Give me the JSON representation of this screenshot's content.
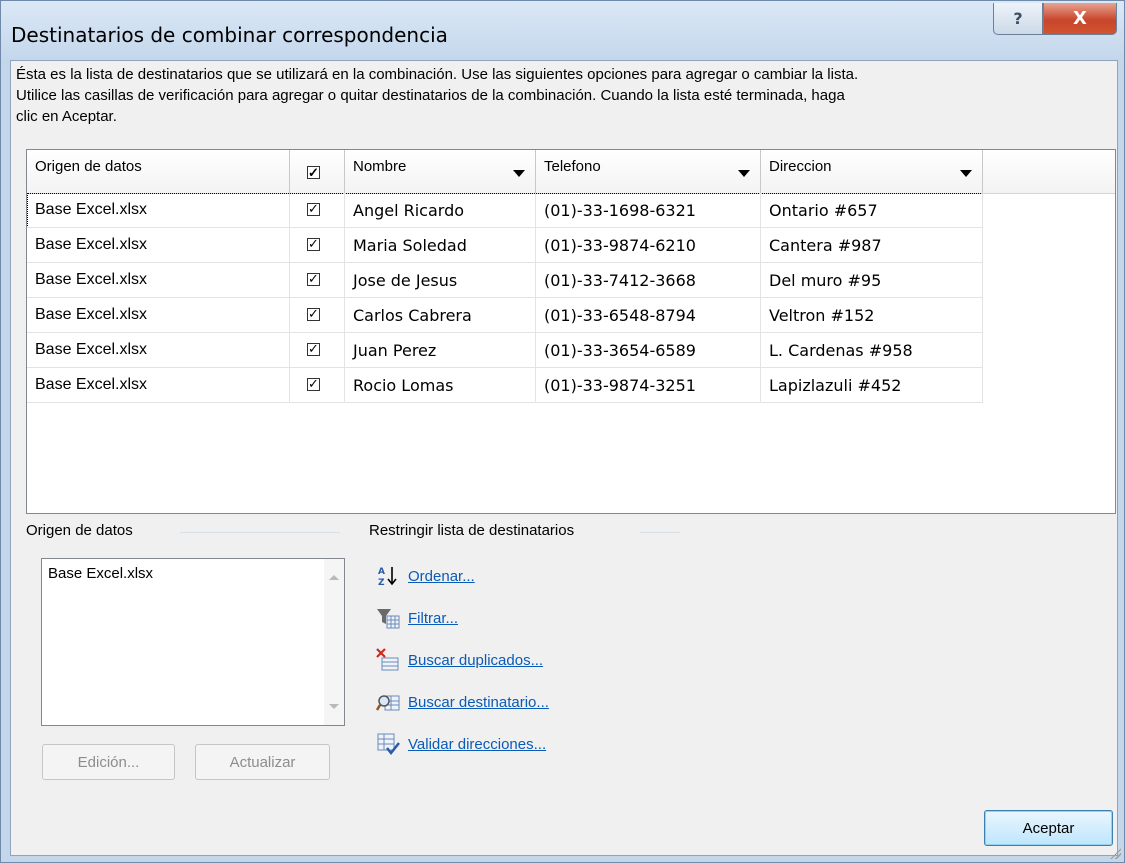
{
  "window": {
    "title": "Destinatarios de combinar correspondencia",
    "help_label": "?",
    "close_label": "X"
  },
  "intro": {
    "line1": "Ésta es la lista de destinatarios que se utilizará en la combinación. Use las siguientes opciones para agregar o cambiar la lista.",
    "line2": "Utilice las casillas de verificación para agregar o quitar destinatarios de la combinación. Cuando la lista esté terminada, haga",
    "line3": "clic en Aceptar."
  },
  "grid": {
    "columns": {
      "source": "Origen de datos",
      "nombre": "Nombre",
      "telefono": "Telefono",
      "direccion": "Direccion"
    },
    "rows": [
      {
        "source": "Base Excel.xlsx",
        "checked": true,
        "nombre": "Angel Ricardo",
        "telefono": "(01)-33-1698-6321",
        "direccion": "Ontario #657"
      },
      {
        "source": "Base Excel.xlsx",
        "checked": true,
        "nombre": "Maria Soledad",
        "telefono": "(01)-33-9874-6210",
        "direccion": "Cantera #987"
      },
      {
        "source": "Base Excel.xlsx",
        "checked": true,
        "nombre": "Jose de Jesus",
        "telefono": "(01)-33-7412-3668",
        "direccion": "Del muro #95"
      },
      {
        "source": "Base Excel.xlsx",
        "checked": true,
        "nombre": "Carlos Cabrera",
        "telefono": "(01)-33-6548-8794",
        "direccion": "Veltron #152"
      },
      {
        "source": "Base Excel.xlsx",
        "checked": true,
        "nombre": "Juan Perez",
        "telefono": "(01)-33-3654-6589",
        "direccion": "L. Cardenas #958"
      },
      {
        "source": "Base Excel.xlsx",
        "checked": true,
        "nombre": "Rocio Lomas",
        "telefono": "(01)-33-9874-3251",
        "direccion": "Lapizlazuli #452"
      }
    ]
  },
  "data_source": {
    "title": "Origen de datos",
    "items": [
      "Base Excel.xlsx"
    ],
    "edit_label": "Edición...",
    "refresh_label": "Actualizar"
  },
  "restrict": {
    "title": "Restringir lista de destinatarios",
    "actions": [
      {
        "label": "Ordenar...",
        "icon": "sort-az-icon"
      },
      {
        "label": "Filtrar...",
        "icon": "filter-icon"
      },
      {
        "label": "Buscar duplicados...",
        "icon": "find-duplicates-icon"
      },
      {
        "label": "Buscar destinatario...",
        "icon": "find-recipient-icon"
      },
      {
        "label": "Validar direcciones...",
        "icon": "validate-addresses-icon"
      }
    ]
  },
  "footer": {
    "ok_label": "Aceptar"
  }
}
